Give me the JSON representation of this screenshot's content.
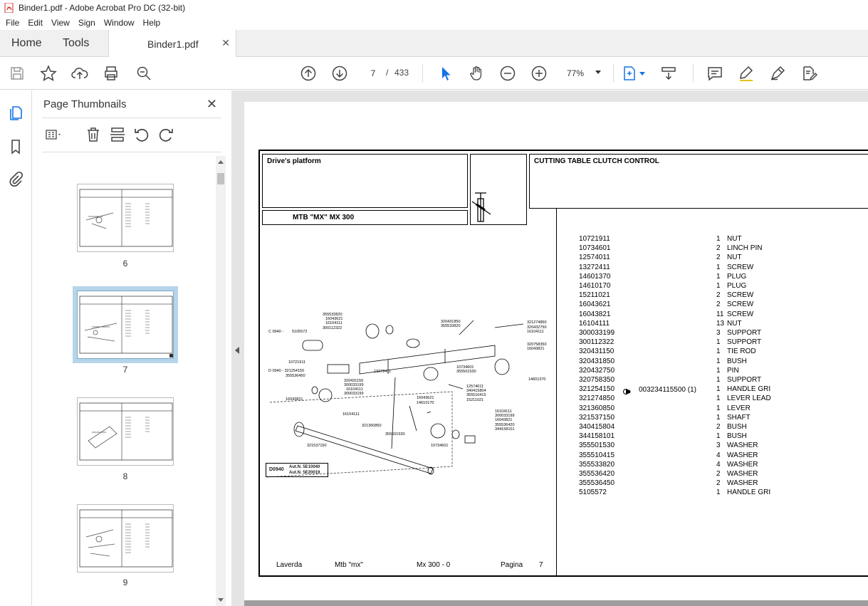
{
  "window": {
    "title": "Binder1.pdf - Adobe Acrobat Pro DC (32-bit)"
  },
  "menu": [
    "File",
    "Edit",
    "View",
    "Sign",
    "Window",
    "Help"
  ],
  "tabs": {
    "home": "Home",
    "tools": "Tools",
    "document": "Binder1.pdf"
  },
  "toolbar": {
    "page_current": "7",
    "page_sep": "/",
    "page_total": "433",
    "zoom": "77%"
  },
  "thumbnails": {
    "title": "Page Thumbnails",
    "pages": [
      {
        "label": "6"
      },
      {
        "label": "7",
        "selected": true
      },
      {
        "label": "8"
      },
      {
        "label": "9"
      }
    ]
  },
  "document": {
    "section": "Drive's platform",
    "model_line": "MTB \"MX\"  MX 300",
    "title": "CUTTING TABLE CLUTCH CONTROL",
    "diagram": {
      "code_box": "D0940",
      "aut1": "Aut.N. 5E10040",
      "aut2": "Aut.N. 5E20019",
      "labels": [
        "355533820",
        "16043621",
        "16104111",
        "300112322",
        "320431850",
        "355533820",
        "321274850",
        "320432750",
        "16104111",
        "320758350",
        "16043821",
        "C 0940 -",
        "5105572",
        "10721911",
        "D 0940 - 321254150",
        "355536450",
        "13272411",
        "10734601",
        "355501530",
        "320431150",
        "300033199",
        "16104111",
        "300033199",
        "12574011",
        "340415804",
        "355510415",
        "15211021",
        "16043621",
        "14610170",
        "16043821",
        "16104111",
        "321360850",
        "355501530",
        "16104111",
        "300033199",
        "16043821",
        "355536420",
        "344158101",
        "10734601",
        "321537150",
        "14601370"
      ]
    },
    "parts": [
      {
        "code": "10721911",
        "qty": "1",
        "desc": "NUT"
      },
      {
        "code": "10734601",
        "qty": "2",
        "desc": "LINCH PIN"
      },
      {
        "code": "12574011",
        "qty": "2",
        "desc": "NUT"
      },
      {
        "code": "13272411",
        "qty": "1",
        "desc": "SCREW"
      },
      {
        "code": "14601370",
        "qty": "1",
        "desc": "PLUG"
      },
      {
        "code": "14610170",
        "qty": "1",
        "desc": "PLUG"
      },
      {
        "code": "15211021",
        "qty": "2",
        "desc": "SCREW"
      },
      {
        "code": "16043621",
        "qty": "2",
        "desc": "SCREW"
      },
      {
        "code": "16043821",
        "qty": "11",
        "desc": "SCREW"
      },
      {
        "code": "16104111",
        "qty": "13",
        "desc": "NUT"
      },
      {
        "code": "300033199",
        "qty": "3",
        "desc": "SUPPORT"
      },
      {
        "code": "300112322",
        "qty": "1",
        "desc": "SUPPORT"
      },
      {
        "code": "320431150",
        "qty": "1",
        "desc": "TIE ROD"
      },
      {
        "code": "320431850",
        "qty": "1",
        "desc": "BUSH"
      },
      {
        "code": "320432750",
        "qty": "1",
        "desc": "PIN"
      },
      {
        "code": "320758350",
        "qty": "1",
        "desc": "SUPPORT"
      },
      {
        "code": "321254150",
        "qty": "1",
        "desc": "HANDLE GRI",
        "note": "003234115500  (1)"
      },
      {
        "code": "321274850",
        "qty": "1",
        "desc": "LEVER LEAD"
      },
      {
        "code": "321360850",
        "qty": "1",
        "desc": "LEVER"
      },
      {
        "code": "321537150",
        "qty": "1",
        "desc": "SHAFT"
      },
      {
        "code": "340415804",
        "qty": "2",
        "desc": "BUSH"
      },
      {
        "code": "344158101",
        "qty": "1",
        "desc": "BUSH"
      },
      {
        "code": "355501530",
        "qty": "3",
        "desc": "WASHER"
      },
      {
        "code": "355510415",
        "qty": "4",
        "desc": "WASHER"
      },
      {
        "code": "355533820",
        "qty": "4",
        "desc": "WASHER"
      },
      {
        "code": "355536420",
        "qty": "2",
        "desc": "WASHER"
      },
      {
        "code": "355536450",
        "qty": "2",
        "desc": "WASHER"
      },
      {
        "code": "5105572",
        "qty": "1",
        "desc": "HANDLE GRI"
      }
    ],
    "footer": {
      "brand": "Laverda",
      "series": "Mtb \"mx\"",
      "model": "Mx 300 - 0",
      "page_label": "Pagina",
      "page_num": "7"
    }
  }
}
